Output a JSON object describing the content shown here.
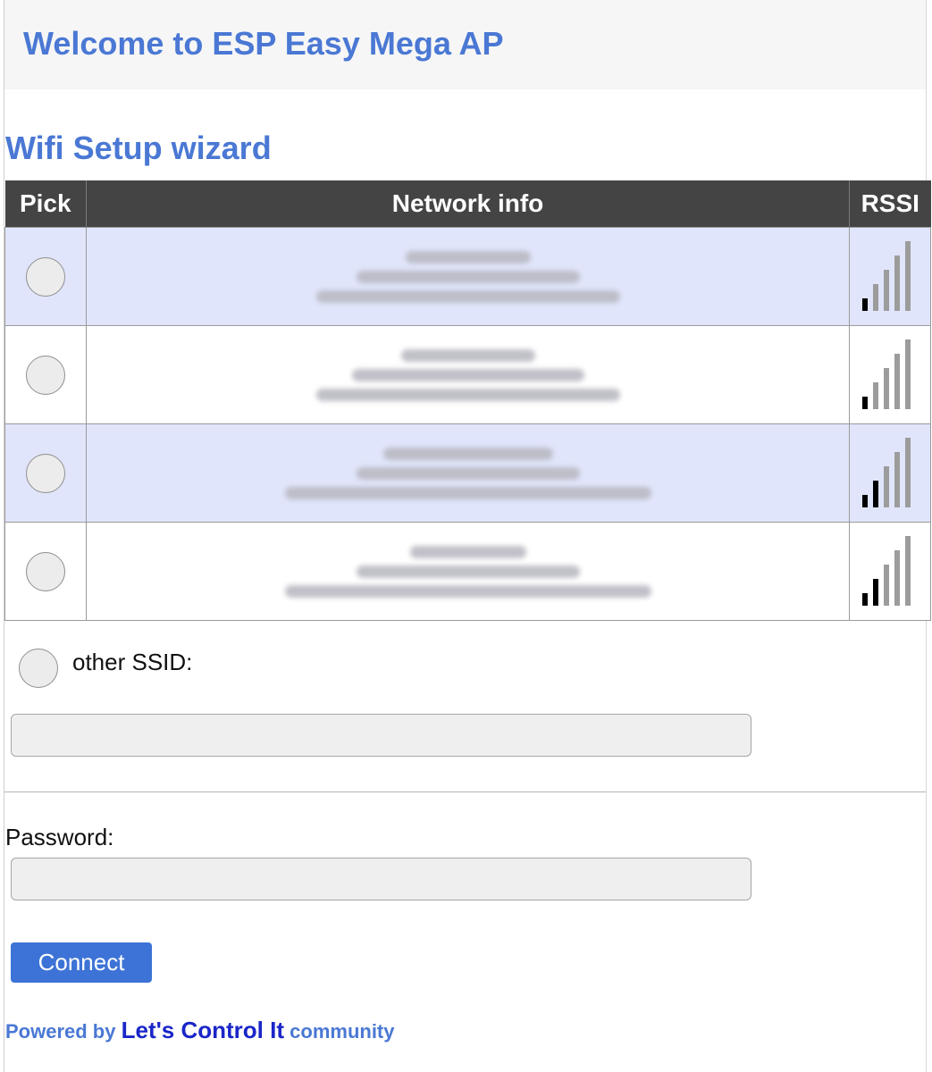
{
  "header": {
    "title": "Welcome to ESP Easy Mega AP"
  },
  "wizard": {
    "title": "Wifi Setup wizard"
  },
  "table": {
    "columns": [
      "Pick",
      "Network info",
      "RSSI"
    ],
    "rows": [
      {
        "signal_bars": 1
      },
      {
        "signal_bars": 1
      },
      {
        "signal_bars": 2
      },
      {
        "signal_bars": 2
      }
    ]
  },
  "other_ssid": {
    "label": "other SSID:",
    "value": ""
  },
  "password": {
    "label": "Password:",
    "value": ""
  },
  "connect_button": {
    "label": "Connect"
  },
  "footer": {
    "prefix": "Powered by",
    "brand": "Let's Control It",
    "suffix": "community"
  },
  "colors": {
    "accent": "#4a78d4",
    "header_bg": "#444444",
    "row_highlight": "#e0e5fb",
    "button": "#3d73d6"
  }
}
